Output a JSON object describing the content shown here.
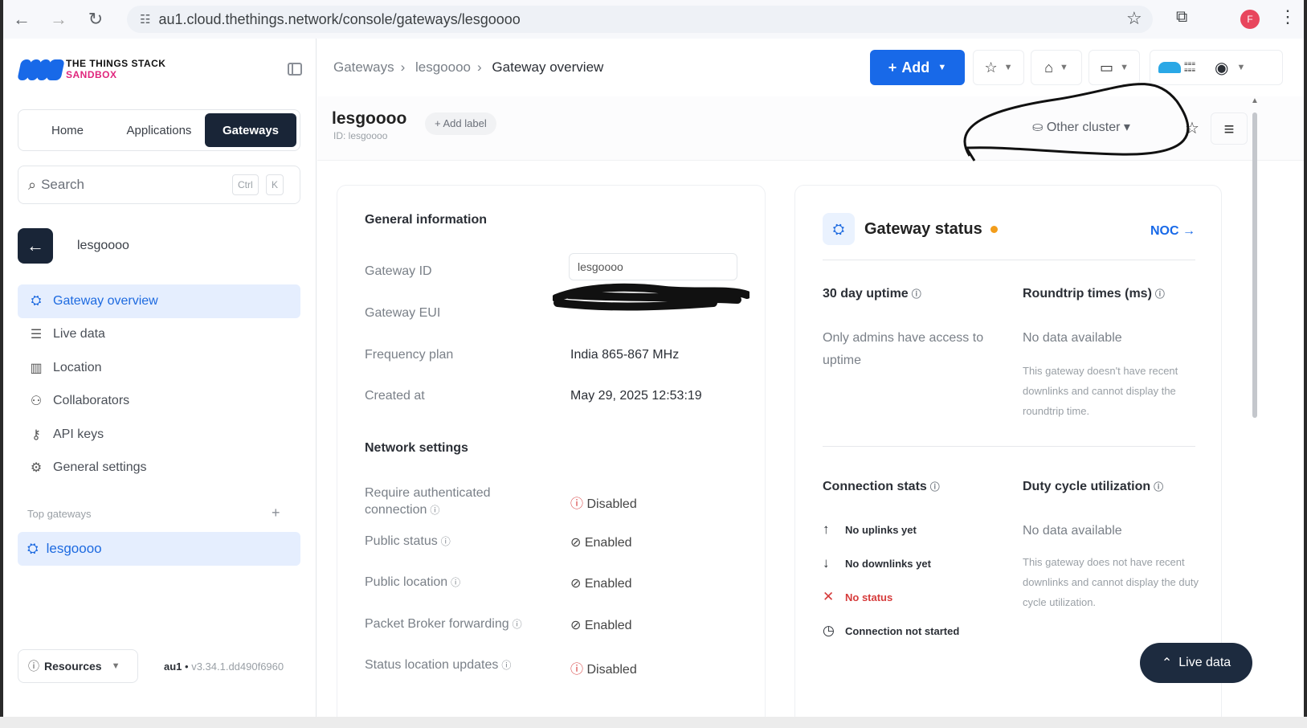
{
  "browser": {
    "url": "au1.cloud.thethings.network/console/gateways/lesgoooo",
    "profile_initial": "F"
  },
  "brand": {
    "line1": "THE THINGS STACK",
    "line2": "SANDBOX"
  },
  "sidebar": {
    "tabs": [
      {
        "label": "Home"
      },
      {
        "label": "Applications"
      },
      {
        "label": "Gateways"
      }
    ],
    "search": {
      "placeholder": "Search",
      "kbd1": "Ctrl",
      "kbd2": "K"
    },
    "context_name": "lesgoooo",
    "items": [
      {
        "label": "Gateway overview",
        "icon": "gateway-icon"
      },
      {
        "label": "Live data",
        "icon": "list-icon"
      },
      {
        "label": "Location",
        "icon": "map-icon"
      },
      {
        "label": "Collaborators",
        "icon": "users-icon"
      },
      {
        "label": "API keys",
        "icon": "key-icon"
      },
      {
        "label": "General settings",
        "icon": "gear-icon"
      }
    ],
    "top_gateways_label": "Top gateways",
    "top_gateway_item": "lesgoooo",
    "resources_label": "Resources",
    "cluster": "au1",
    "version": "v3.34.1.dd490f6960"
  },
  "header": {
    "breadcrumbs": [
      "Gateways",
      "lesgoooo",
      "Gateway overview"
    ],
    "add_label": "Add"
  },
  "gateway": {
    "name": "lesgoooo",
    "id_line": "ID: lesgoooo",
    "add_label": "Add label",
    "cluster_label": "Other cluster"
  },
  "general": {
    "title": "General information",
    "gateway_id_label": "Gateway ID",
    "gateway_id_value": "lesgoooo",
    "eui_label": "Gateway EUI",
    "freq_label": "Frequency plan",
    "freq_value": "India 865-867 MHz",
    "created_label": "Created at",
    "created_value": "May 29, 2025 12:53:19",
    "network_title": "Network settings",
    "settings": [
      {
        "label": "Require authenticated connection",
        "value": "Disabled",
        "state": "disabled"
      },
      {
        "label": "Public status",
        "value": "Enabled",
        "state": "enabled"
      },
      {
        "label": "Public location",
        "value": "Enabled",
        "state": "enabled"
      },
      {
        "label": "Packet Broker forwarding",
        "value": "Enabled",
        "state": "enabled"
      },
      {
        "label": "Status location updates",
        "value": "Disabled",
        "state": "disabled"
      }
    ]
  },
  "status": {
    "title": "Gateway status",
    "noc_label": "NOC →",
    "uptime_title": "30 day uptime",
    "uptime_text": "Only admins have access to uptime",
    "rtt_title": "Roundtrip times (ms)",
    "rtt_value": "No data available",
    "rtt_note": "This gateway doesn't have recent downlinks and cannot display the roundtrip time.",
    "conn_title": "Connection stats",
    "conn_items": [
      "No uplinks yet",
      "No downlinks yet",
      "No status",
      "Connection not started"
    ],
    "duty_title": "Duty cycle utilization",
    "duty_value": "No data available",
    "duty_note": "This gateway does not have recent downlinks and cannot display the duty cycle utilization."
  },
  "live_data_button": "Live data",
  "colors": {
    "accent": "#1869e8",
    "dark": "#192537",
    "brand_pink": "#e0267d",
    "warning_dot": "#f29d1b",
    "danger": "#d63b3b"
  }
}
